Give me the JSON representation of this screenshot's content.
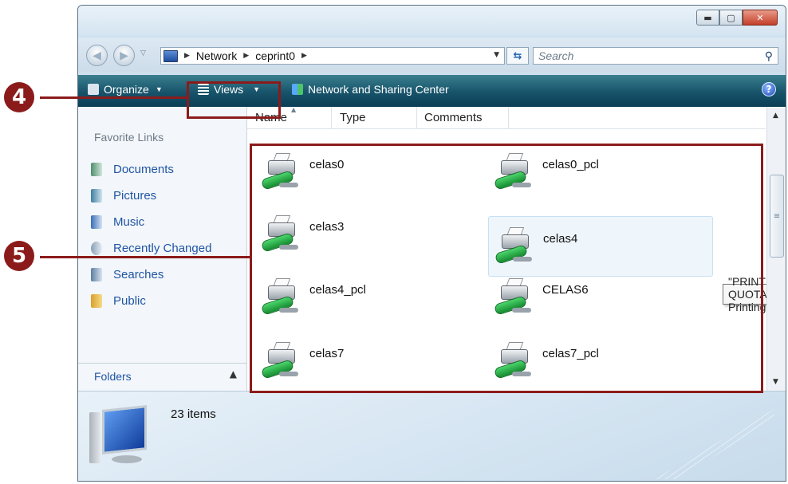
{
  "address": {
    "crumbs": [
      "Network",
      "ceprint0"
    ]
  },
  "search": {
    "placeholder": "Search"
  },
  "toolbar": {
    "organize": "Organize",
    "views": "Views",
    "network_center": "Network and Sharing Center"
  },
  "nav": {
    "header": "Favorite Links",
    "items": [
      "Documents",
      "Pictures",
      "Music",
      "Recently Changed",
      "Searches",
      "Public"
    ],
    "folders": "Folders"
  },
  "columns": [
    "Name",
    "Type",
    "Comments"
  ],
  "items": [
    "celas0",
    "celas0_pcl",
    "celas3",
    "celas4",
    "celas4_pcl",
    "CELAS6",
    "celas7",
    "celas7_pcl"
  ],
  "tooltip": "\"PRINT QUOTA\" Printing",
  "details": {
    "count": "23 items"
  },
  "callouts": [
    "4",
    "5"
  ],
  "colors": {
    "callout": "#8b1b1b",
    "toolbar": "#17536a",
    "link": "#1f56a3"
  }
}
